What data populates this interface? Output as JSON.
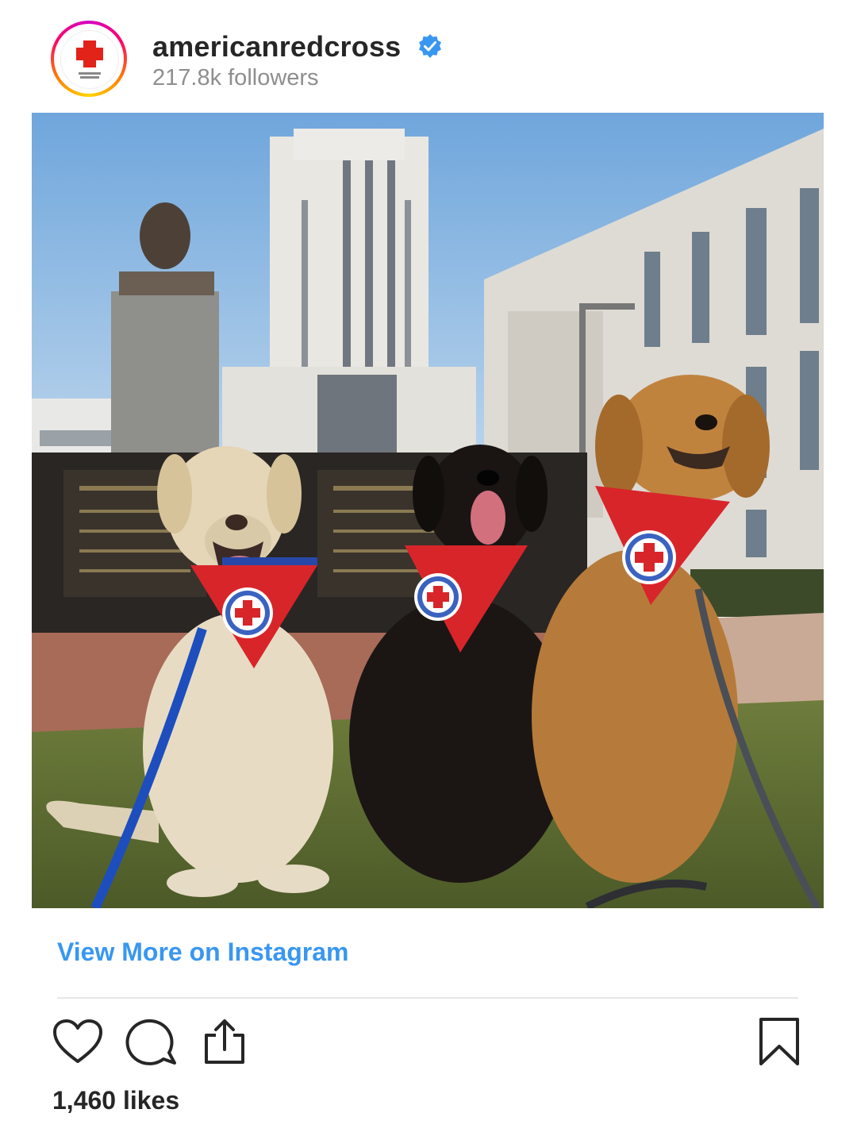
{
  "post": {
    "username": "americanredcross",
    "followers": "217.8k followers",
    "verified": true,
    "view_more_label": "View More on Instagram",
    "likes": "1,460 likes"
  },
  "photo": {
    "description_icon": "photo-three-therapy-dogs"
  },
  "actions": {
    "icons": [
      "heart-icon",
      "comment-icon",
      "share-icon",
      "bookmark-icon"
    ]
  },
  "colors": {
    "link": "#3897f0",
    "verified": "#3897f0",
    "text": "#262626",
    "muted": "#8e8e8e",
    "brand_red": "#e2231a"
  }
}
